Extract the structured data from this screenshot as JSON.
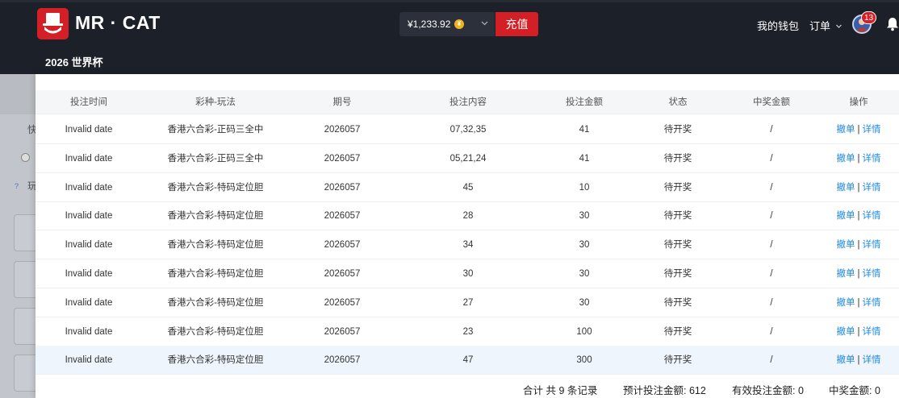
{
  "header": {
    "brand": "MR · CAT",
    "subtitle": "2026 世界杯",
    "balance": "¥1,233.92",
    "coin_symbol": "¥",
    "recharge_label": "充值",
    "wallet_label": "我的钱包",
    "orders_label": "订单",
    "notification_count": "13"
  },
  "backdrop": {
    "label_top": "快",
    "label_mid": "玩"
  },
  "table": {
    "columns": [
      "投注时间",
      "彩种-玩法",
      "期号",
      "投注内容",
      "投注金额",
      "状态",
      "中奖金额",
      "操作"
    ],
    "rows": [
      {
        "time": "Invalid date",
        "game": "香港六合彩-正码三全中",
        "issue": "2026057",
        "content": "07,32,35",
        "amount": "41",
        "status": "待开奖",
        "win": "/",
        "cancel": "撤单",
        "sep": "|",
        "detail": "详情"
      },
      {
        "time": "Invalid date",
        "game": "香港六合彩-正码三全中",
        "issue": "2026057",
        "content": "05,21,24",
        "amount": "41",
        "status": "待开奖",
        "win": "/",
        "cancel": "撤单",
        "sep": "|",
        "detail": "详情"
      },
      {
        "time": "Invalid date",
        "game": "香港六合彩-特码定位胆",
        "issue": "2026057",
        "content": "45",
        "amount": "10",
        "status": "待开奖",
        "win": "/",
        "cancel": "撤单",
        "sep": "|",
        "detail": "详情"
      },
      {
        "time": "Invalid date",
        "game": "香港六合彩-特码定位胆",
        "issue": "2026057",
        "content": "28",
        "amount": "30",
        "status": "待开奖",
        "win": "/",
        "cancel": "撤单",
        "sep": "|",
        "detail": "详情"
      },
      {
        "time": "Invalid date",
        "game": "香港六合彩-特码定位胆",
        "issue": "2026057",
        "content": "34",
        "amount": "30",
        "status": "待开奖",
        "win": "/",
        "cancel": "撤单",
        "sep": "|",
        "detail": "详情"
      },
      {
        "time": "Invalid date",
        "game": "香港六合彩-特码定位胆",
        "issue": "2026057",
        "content": "30",
        "amount": "30",
        "status": "待开奖",
        "win": "/",
        "cancel": "撤单",
        "sep": "|",
        "detail": "详情"
      },
      {
        "time": "Invalid date",
        "game": "香港六合彩-特码定位胆",
        "issue": "2026057",
        "content": "27",
        "amount": "30",
        "status": "待开奖",
        "win": "/",
        "cancel": "撤单",
        "sep": "|",
        "detail": "详情"
      },
      {
        "time": "Invalid date",
        "game": "香港六合彩-特码定位胆",
        "issue": "2026057",
        "content": "23",
        "amount": "100",
        "status": "待开奖",
        "win": "/",
        "cancel": "撤单",
        "sep": "|",
        "detail": "详情"
      },
      {
        "time": "Invalid date",
        "game": "香港六合彩-特码定位胆",
        "issue": "2026057",
        "content": "47",
        "amount": "300",
        "status": "待开奖",
        "win": "/",
        "cancel": "撤单",
        "sep": "|",
        "detail": "详情"
      }
    ]
  },
  "summary": {
    "records": "合计 共 9 条记录",
    "expected": "预计投注金额: 612",
    "effective": "有效投注金额: 0",
    "winning": "中奖金额: 0"
  },
  "icons": {
    "logo": "cat-hat-logo-icon",
    "coin": "coin-icon",
    "dropdown": "chevron-down-icon",
    "avatar": "user-avatar-icon",
    "bell": "bell-icon"
  },
  "colors": {
    "header_bg": "#1c2029",
    "brand_red": "#d51f26",
    "link_blue": "#1e88e5",
    "row_highlight": "#eef5fd"
  }
}
